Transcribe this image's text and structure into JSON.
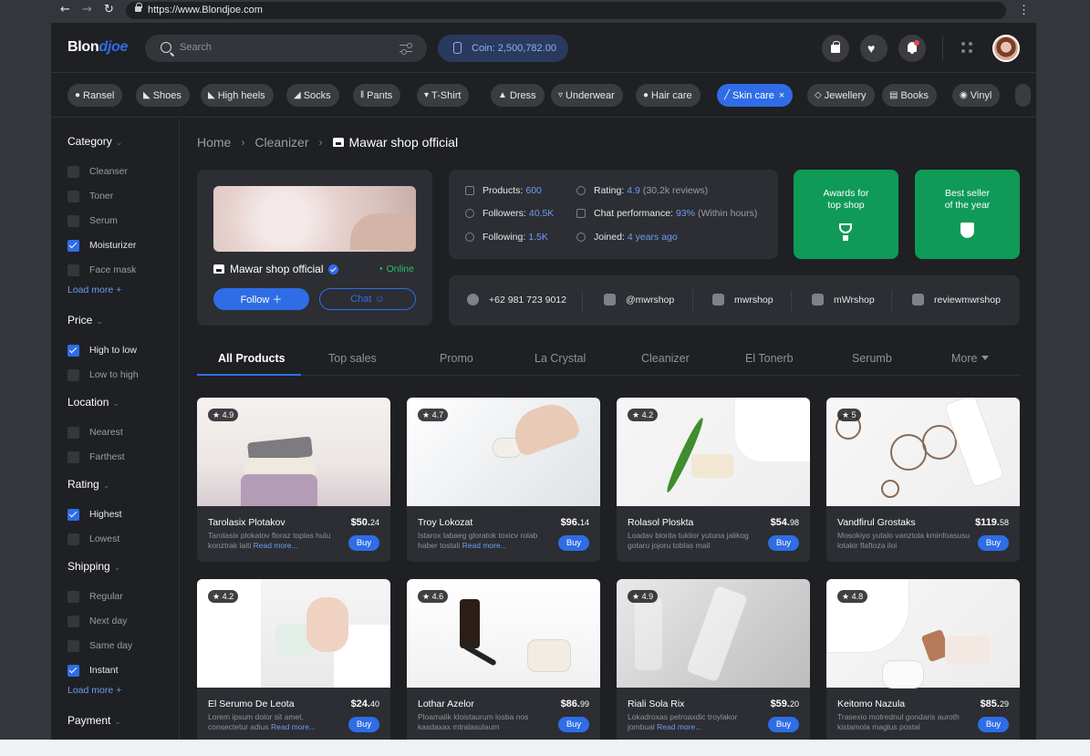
{
  "browser": {
    "back": "←",
    "forward": "→",
    "reload": "↻",
    "url": "https://www.Blondjoe.com",
    "menu": "⋮"
  },
  "header": {
    "logo_main": "Blon",
    "logo_accent": "djoe",
    "search_placeholder": "Search",
    "coin_label": "Coin: 2,500,782.00",
    "heart": "♥"
  },
  "categories": [
    {
      "label": "Ransel",
      "icon": "●"
    },
    {
      "label": "Shoes",
      "icon": "◣"
    },
    {
      "label": "High heels",
      "icon": "◣"
    },
    {
      "label": "Socks",
      "icon": "◢"
    },
    {
      "label": "Pants",
      "icon": "‖"
    },
    {
      "label": "T-Shirt",
      "icon": "▾"
    },
    {
      "label": "Dress",
      "icon": "▲"
    },
    {
      "label": "Underwear",
      "icon": "▿"
    },
    {
      "label": "Hair care",
      "icon": "●"
    },
    {
      "label": "Skin care",
      "icon": "╱",
      "active": true,
      "close": "×"
    },
    {
      "label": "Jewellery",
      "icon": "◇"
    },
    {
      "label": "Books",
      "icon": "▤"
    },
    {
      "label": "Vinyl",
      "icon": "◉"
    }
  ],
  "sidebar": {
    "category": {
      "title": "Category",
      "items": [
        {
          "label": "Cleanser",
          "checked": false
        },
        {
          "label": "Toner",
          "checked": false
        },
        {
          "label": "Serum",
          "checked": false
        },
        {
          "label": "Moisturizer",
          "checked": true
        },
        {
          "label": "Face mask",
          "checked": false
        }
      ],
      "load_more": "Load more +"
    },
    "price": {
      "title": "Price",
      "items": [
        {
          "label": "High to low",
          "checked": true
        },
        {
          "label": "Low to high",
          "checked": false
        }
      ]
    },
    "location": {
      "title": "Location",
      "items": [
        {
          "label": "Nearest",
          "checked": false
        },
        {
          "label": "Farthest",
          "checked": false
        }
      ]
    },
    "rating": {
      "title": "Rating",
      "items": [
        {
          "label": "Highest",
          "checked": true
        },
        {
          "label": "Lowest",
          "checked": false
        }
      ]
    },
    "shipping": {
      "title": "Shipping",
      "items": [
        {
          "label": "Regular",
          "checked": false
        },
        {
          "label": "Next day",
          "checked": false
        },
        {
          "label": "Same day",
          "checked": false
        },
        {
          "label": "Instant",
          "checked": true
        }
      ],
      "load_more": "Load more +"
    },
    "payment": {
      "title": "Payment"
    },
    "chevron": "⌄"
  },
  "breadcrumb": {
    "home": "Home",
    "section": "Cleanizer",
    "current": "Mawar shop official",
    "separator": "›"
  },
  "shop": {
    "name": "Mawar shop official",
    "status": "Online",
    "follow_label": "Follow ＋",
    "chat_label": "Chat ☺"
  },
  "stats": {
    "products_label": "Products:",
    "products_value": "600",
    "followers_label": "Followers:",
    "followers_value": "40.5K",
    "following_label": "Following:",
    "following_value": "1.5K",
    "rating_label": "Rating:",
    "rating_value": "4.9",
    "rating_reviews": "(30.2k reviews)",
    "chat_label": "Chat performance:",
    "chat_value": "93%",
    "chat_note": "(Within hours)",
    "joined_label": "Joined:",
    "joined_value": "4 years ago"
  },
  "awards": [
    {
      "line1": "Awards for",
      "line2": "top shop"
    },
    {
      "line1": "Best seller",
      "line2": "of the year"
    }
  ],
  "contacts": {
    "whatsapp": "+62 981 723 9012",
    "instagram": "@mwrshop",
    "facebook": "mwrshop",
    "store": "mWrshop",
    "youtube": "reviewmwrshop"
  },
  "tabs": [
    "All Products",
    "Top sales",
    "Promo",
    "La Crystal",
    "Cleanizer",
    "El Tonerb",
    "Serumb",
    "More"
  ],
  "products": [
    {
      "rating": "★ 4.9",
      "name": "Tarolasix Plotakov",
      "price_main": "$50.",
      "price_cents": "24",
      "desc": "Tarolasix plokatov floraz toplas hulu konztrak laiti ",
      "read_more": "Read more...",
      "buy": "Buy"
    },
    {
      "rating": "★ 4.7",
      "name": "Troy Lokozat",
      "price_main": "$96.",
      "price_cents": "14",
      "desc": "Istarox labaeg gloratok toxicv rolab haber tostali ",
      "read_more": "Read more...",
      "buy": "Buy"
    },
    {
      "rating": "★ 4.2",
      "name": "Rolasol Ploskta",
      "price_main": "$54.",
      "price_cents": "98",
      "desc": "Loadav blorita tuklior yutuna jalikog gotaru jojoru toblas mail",
      "read_more": "",
      "buy": "Buy"
    },
    {
      "rating": "★ 5",
      "name": "Vandfirul Grostaks",
      "price_main": "$119.",
      "price_cents": "58",
      "desc": "Mosokiyo yutalo vanztola kminfoasusu lotakir flaftoza iloi",
      "read_more": "",
      "buy": "Buy"
    },
    {
      "rating": "★ 4.2",
      "name": "El Serumo De Leota",
      "price_main": "$24.",
      "price_cents": "40",
      "desc": "Lorem ipsum dolor sit amet, consectetur adius ",
      "read_more": "Read more...",
      "buy": "Buy"
    },
    {
      "rating": "★ 4.6",
      "name": "Lothar Azelor",
      "price_main": "$86.",
      "price_cents": "99",
      "desc": "Ploamalik kloistaurum losba nos kasdaxax mtralasulaum",
      "read_more": "",
      "buy": "Buy"
    },
    {
      "rating": "★ 4.9",
      "name": "Riali Sola Rix",
      "price_main": "$59.",
      "price_cents": "20",
      "desc": "Lokadroxas petroaxdic troylakor jombual ",
      "read_more": "Read more...",
      "buy": "Buy"
    },
    {
      "rating": "★ 4.8",
      "name": "Keitomo Nazula",
      "price_main": "$85.",
      "price_cents": "29",
      "desc": "Trasexio motrednul gondaris auroth kistamola maglus postal",
      "read_more": "",
      "buy": "Buy"
    }
  ],
  "colors": {
    "accent": "#2f6de6",
    "success": "#0f9a57",
    "online": "#2fbf6a",
    "surface": "#2c2e33",
    "background": "#1f2024"
  }
}
